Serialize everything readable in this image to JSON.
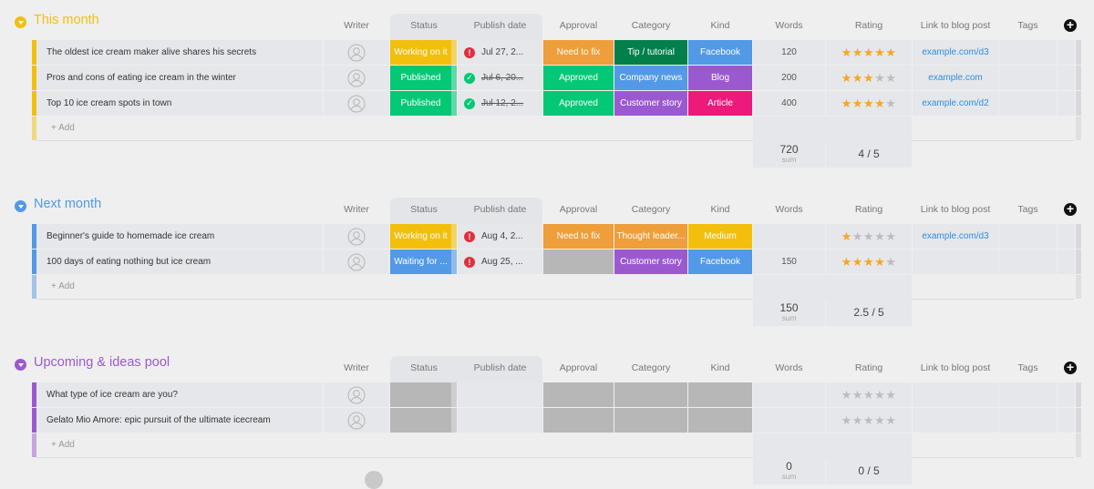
{
  "colors": {
    "yellow": "#f2bf0d",
    "green": "#03c875",
    "orange": "#ee9e3a",
    "dark_green": "#037f4c",
    "blue": "#5299e6",
    "purple": "#9b59d0",
    "pink": "#ed1a7c",
    "grey": "#b7b7b7",
    "alert_red": "#e0303f",
    "check_green": "#03c875"
  },
  "columns": {
    "writer": "Writer",
    "status": "Status",
    "publish_date": "Publish date",
    "approval": "Approval",
    "category": "Category",
    "kind": "Kind",
    "words": "Words",
    "rating": "Rating",
    "link": "Link to blog post",
    "tags": "Tags"
  },
  "add_row_label": "+ Add",
  "sum_label": "sum",
  "groups": [
    {
      "title": "This month",
      "color": "#f2bf0d",
      "rows": [
        {
          "name": "The oldest ice cream maker alive shares his secrets",
          "status": "Working on it",
          "status_color": "#f2bf0d",
          "date_icon": "alert",
          "date": "Jul 27, 2...",
          "date_done": false,
          "approval": "Need to fix",
          "approval_color": "#ee9e3a",
          "category": "Tip / tutorial",
          "category_color": "#037f4c",
          "kind": "Facebook",
          "kind_color": "#5299e6",
          "words": "120",
          "rating": 5,
          "link": "example.com/d3"
        },
        {
          "name": "Pros and cons of eating ice cream in the winter",
          "status": "Published",
          "status_color": "#03c875",
          "date_icon": "check",
          "date": "Jul 6, 20...",
          "date_done": true,
          "approval": "Approved",
          "approval_color": "#03c875",
          "category": "Company news",
          "category_color": "#5299e6",
          "kind": "Blog",
          "kind_color": "#9b59d0",
          "words": "200",
          "rating": 3,
          "link": "example.com"
        },
        {
          "name": "Top 10 ice cream spots in town",
          "status": "Published",
          "status_color": "#03c875",
          "date_icon": "check",
          "date": "Jul 12, 2...",
          "date_done": true,
          "approval": "Approved",
          "approval_color": "#03c875",
          "category": "Customer story",
          "category_color": "#9b59d0",
          "kind": "Article",
          "kind_color": "#ed1a7c",
          "words": "400",
          "rating": 4,
          "link": "example.com/d2"
        }
      ],
      "summary": {
        "words": "720",
        "rating": "4 / 5"
      }
    },
    {
      "title": "Next month",
      "color": "#5299e6",
      "rows": [
        {
          "name": "Beginner's guide to homemade ice cream",
          "status": "Working on it",
          "status_color": "#f2bf0d",
          "date_icon": "alert",
          "date": "Aug 4, 2...",
          "date_done": false,
          "approval": "Need to fix",
          "approval_color": "#ee9e3a",
          "category": "Thought leader...",
          "category_color": "#ee9e3a",
          "kind": "Medium",
          "kind_color": "#f2bf0d",
          "words": "",
          "rating": 1,
          "link": "example.com/d3"
        },
        {
          "name": "100 days of eating nothing but ice cream",
          "status": "Waiting for ...",
          "status_color": "#5299e6",
          "date_icon": "alert",
          "date": "Aug 25, ...",
          "date_done": false,
          "approval": "",
          "approval_color": "#b7b7b7",
          "category": "Customer story",
          "category_color": "#9b59d0",
          "kind": "Facebook",
          "kind_color": "#5299e6",
          "words": "150",
          "rating": 4,
          "link": ""
        }
      ],
      "summary": {
        "words": "150",
        "rating": "2.5 / 5"
      }
    },
    {
      "title": "Upcoming & ideas pool",
      "color": "#9b59d0",
      "rows": [
        {
          "name": "What type of ice cream are you?",
          "status": "",
          "status_color": "#b7b7b7",
          "date_icon": "",
          "date": "",
          "date_done": false,
          "approval": "",
          "approval_color": "#b7b7b7",
          "category": "",
          "category_color": "#b7b7b7",
          "kind": "",
          "kind_color": "#b7b7b7",
          "words": "",
          "rating": 0,
          "link": ""
        },
        {
          "name": "Gelato Mio Amore: epic pursuit of the ultimate icecream",
          "status": "",
          "status_color": "#b7b7b7",
          "date_icon": "",
          "date": "",
          "date_done": false,
          "approval": "",
          "approval_color": "#b7b7b7",
          "category": "",
          "category_color": "#b7b7b7",
          "kind": "",
          "kind_color": "#b7b7b7",
          "words": "",
          "rating": 0,
          "link": ""
        }
      ],
      "summary": {
        "words": "0",
        "rating": "0 / 5"
      }
    }
  ]
}
